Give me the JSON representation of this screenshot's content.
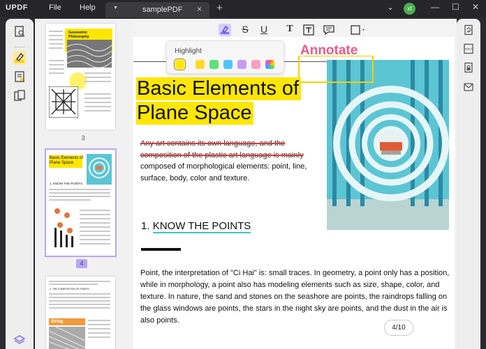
{
  "app": {
    "logo": "UPDF",
    "menu": [
      "File",
      "Help"
    ]
  },
  "tab": {
    "label": "samplePDF",
    "close": "×",
    "add": "+"
  },
  "titlebar": {
    "chevron": "⌄",
    "user_initials": "xf",
    "minimize": "—",
    "maximize": "☐",
    "close": "✕"
  },
  "toolbar": {
    "strikethrough": "S",
    "underline": "U",
    "text": "T"
  },
  "highlight_popup": {
    "label": "Highlight",
    "colors": [
      "#ffe600",
      "#ffd92a",
      "#5de07a",
      "#4fc3f7",
      "#c59cf2",
      "#ff9ec4",
      "rainbow"
    ]
  },
  "annotation": {
    "callout": "Annotate",
    "color": "#ec5a8b"
  },
  "thumbnails": {
    "page3_label": "3",
    "page4_label": "4",
    "page3_title": "Geometric Philosophy",
    "page4_title": "Basic Elements of Plane Space",
    "page4_section": "1. KNOW THE POINTS",
    "page5_string": "String",
    "page5_heading": "2. THE COMPOSITION OF POINTS"
  },
  "document": {
    "heading_line1": "Basic Elements of",
    "heading_line2": "Plane Space",
    "strike_line1": "Any art contains its own language, and the",
    "strike_line2": "composition of the plastic art language is mainly",
    "body_line1": "composed of morphological elements: point, line,",
    "body_line2": "surface, body, color and texture.",
    "section_number": "1.",
    "section_title": "KNOW THE POINTS",
    "paragraph": [
      "Point, the interpretation of \"Ci Hai\" is: small traces. In geometry, a point only has a position,",
      "while in morphology, a point also has modeling elements such as size, shape, color, and",
      "texture. In nature, the sand and stones on the seashore are points, the raindrops falling on",
      "the glass windows are points, the stars in the night sky are points, and the dust in the air is",
      "also points."
    ],
    "page_indicator": "4/10"
  },
  "colors": {
    "highlight": "#ffe600",
    "accent": "#8a6cf0",
    "underline": "#39c7c2",
    "strike": "#d23b3b",
    "pool": "#5cc5d4"
  },
  "icons": {
    "left_rail": [
      "thumbnail-view-icon",
      "comment-icon",
      "edit-pdf-icon",
      "organize-pages-icon",
      "layers-icon"
    ],
    "right_rail": [
      "convert-icon",
      "pdfa-icon",
      "protect-icon",
      "mail-icon"
    ]
  }
}
